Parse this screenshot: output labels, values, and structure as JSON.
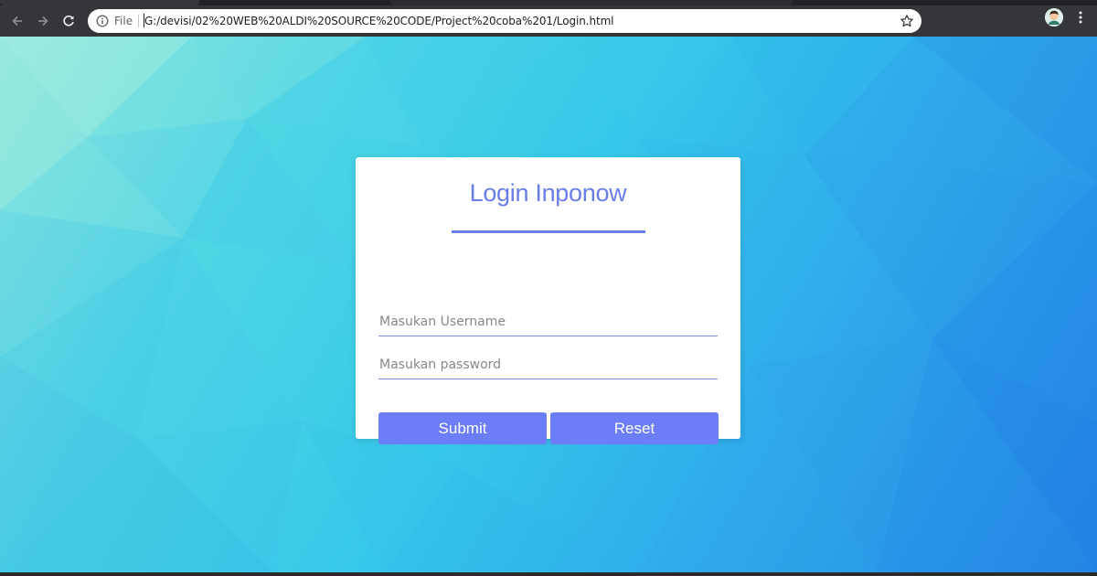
{
  "browser": {
    "file_label": "File",
    "url": "G:/devisi/02%20WEB%20ALDI%20SOURCE%20CODE/Project%20coba%201/Login.html",
    "icons": [
      "back-arrow-icon",
      "forward-arrow-icon",
      "reload-icon",
      "info-icon",
      "bookmark-star-icon",
      "profile-avatar",
      "kebab-menu-icon"
    ]
  },
  "login": {
    "title": "Login Inponow",
    "username_placeholder": "Masukan Username",
    "password_placeholder": "Masukan password",
    "submit_label": "Submit",
    "reset_label": "Reset"
  },
  "colors": {
    "accent": "#6b7ee6",
    "button": "#6b7ef7",
    "chrome_toolbar": "#35363a"
  }
}
